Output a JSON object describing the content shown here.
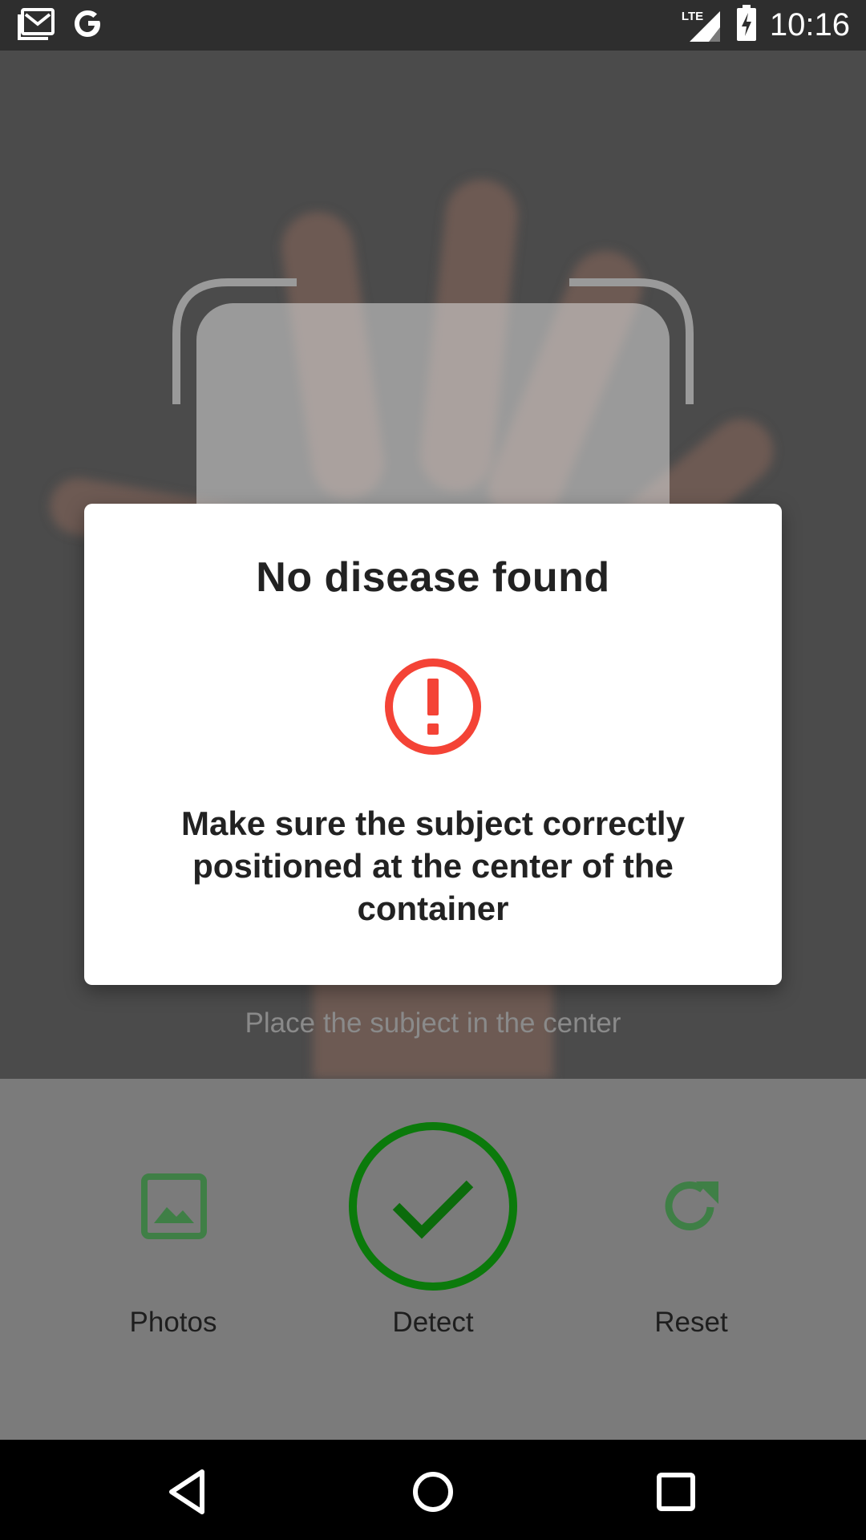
{
  "status_bar": {
    "time": "10:16",
    "network_label": "LTE",
    "icons": [
      "gmail-icon",
      "google-icon",
      "lte-signal-icon",
      "battery-charging-icon"
    ]
  },
  "camera": {
    "hint": "Place the subject in the center"
  },
  "controls": {
    "photos_label": "Photos",
    "detect_label": "Detect",
    "reset_label": "Reset",
    "accent_color": "#0b7a0b"
  },
  "dialog": {
    "title": "No disease found",
    "message": "Make sure the subject correctly positioned at the center of the container",
    "icon": "alert-circle-icon",
    "icon_color": "#f44336"
  },
  "nav_bar": {
    "icons": [
      "back-icon",
      "home-icon",
      "recents-icon"
    ]
  }
}
